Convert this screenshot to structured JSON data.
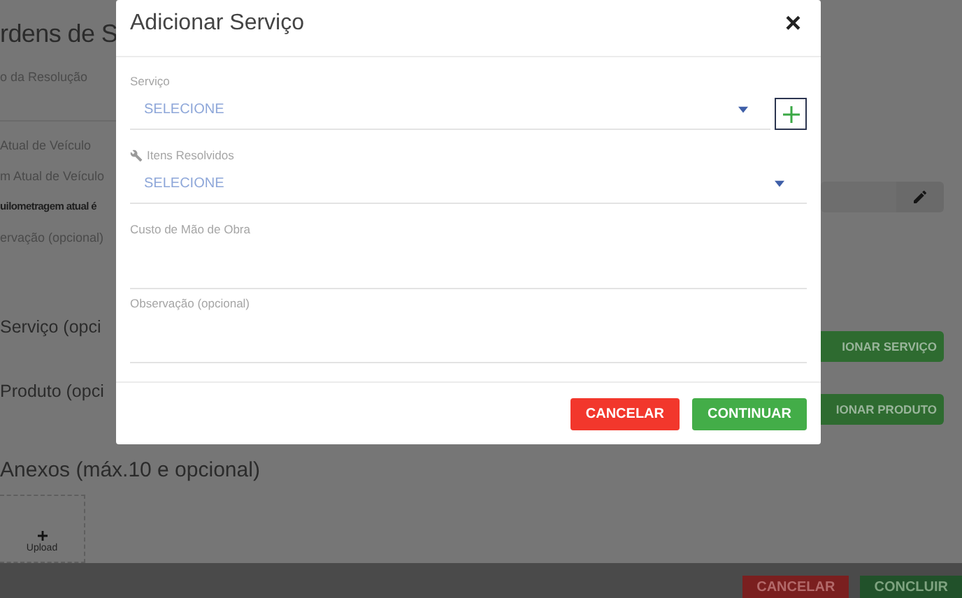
{
  "background_page": {
    "title": "rdens de S",
    "left_fields": [
      {
        "text": "o da Resolução",
        "bold": false
      },
      {
        "text": "Atual de Veículo",
        "bold": false
      },
      {
        "text": "m Atual de Veículo",
        "bold": false
      },
      {
        "text": "uilometragem atual é",
        "bold": true
      },
      {
        "text": "ervação (opcional)",
        "bold": false
      }
    ],
    "sections": [
      {
        "title": "Serviço (opci",
        "button": "IONAR SERVIÇO"
      },
      {
        "title": "Produto (opci",
        "button": "IONAR PRODUTO"
      }
    ],
    "attachments": {
      "title": "Anexos (máx.10 e opcional)",
      "upload": "Upload"
    },
    "footer_buttons": [
      {
        "label": "CANCELAR",
        "kind": "danger"
      },
      {
        "label": "CONCLUIR",
        "kind": "primary"
      }
    ]
  },
  "dialog": {
    "title": "Adicionar Serviço",
    "close": "×",
    "fields": [
      {
        "kind": "select",
        "label": "Serviço",
        "value": "SELECIONE",
        "add_button": true,
        "label_icon": false
      },
      {
        "kind": "select",
        "label": "Itens Resolvidos",
        "value": "SELECIONE",
        "add_button": false,
        "label_icon": true
      },
      {
        "kind": "text",
        "label": "Custo de Mão de Obra"
      },
      {
        "kind": "text",
        "label": "Observação (opcional)"
      }
    ],
    "buttons": [
      {
        "label": "CANCELAR",
        "kind": "danger"
      },
      {
        "label": "CONTINUAR",
        "kind": "primary"
      }
    ]
  }
}
